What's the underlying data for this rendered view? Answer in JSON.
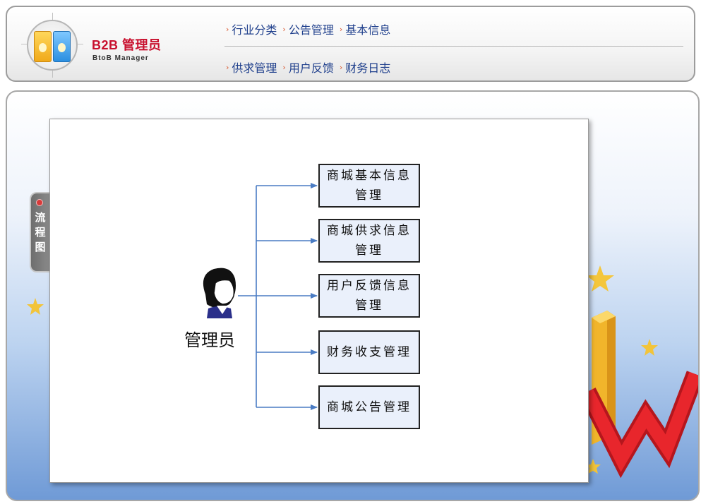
{
  "header": {
    "brand_title": "B2B 管理员",
    "brand_subtitle": "BtoB Manager",
    "nav_row1": [
      "行业分类",
      "公告管理",
      "基本信息"
    ],
    "nav_row2": [
      "供求管理",
      "用户反馈",
      "财务日志"
    ]
  },
  "side_tab": {
    "label": "流程图"
  },
  "flowchart": {
    "actor_label": "管理员",
    "boxes": [
      "商城基本信息管理",
      "商城供求信息管理",
      "用户反馈信息管理",
      "财务收支管理",
      "商城公告管理"
    ]
  },
  "colors": {
    "brand_red": "#c8102e",
    "nav_text": "#1f3f8c",
    "arrow_blue": "#4a7cc4",
    "box_fill": "#eaf0fb"
  }
}
